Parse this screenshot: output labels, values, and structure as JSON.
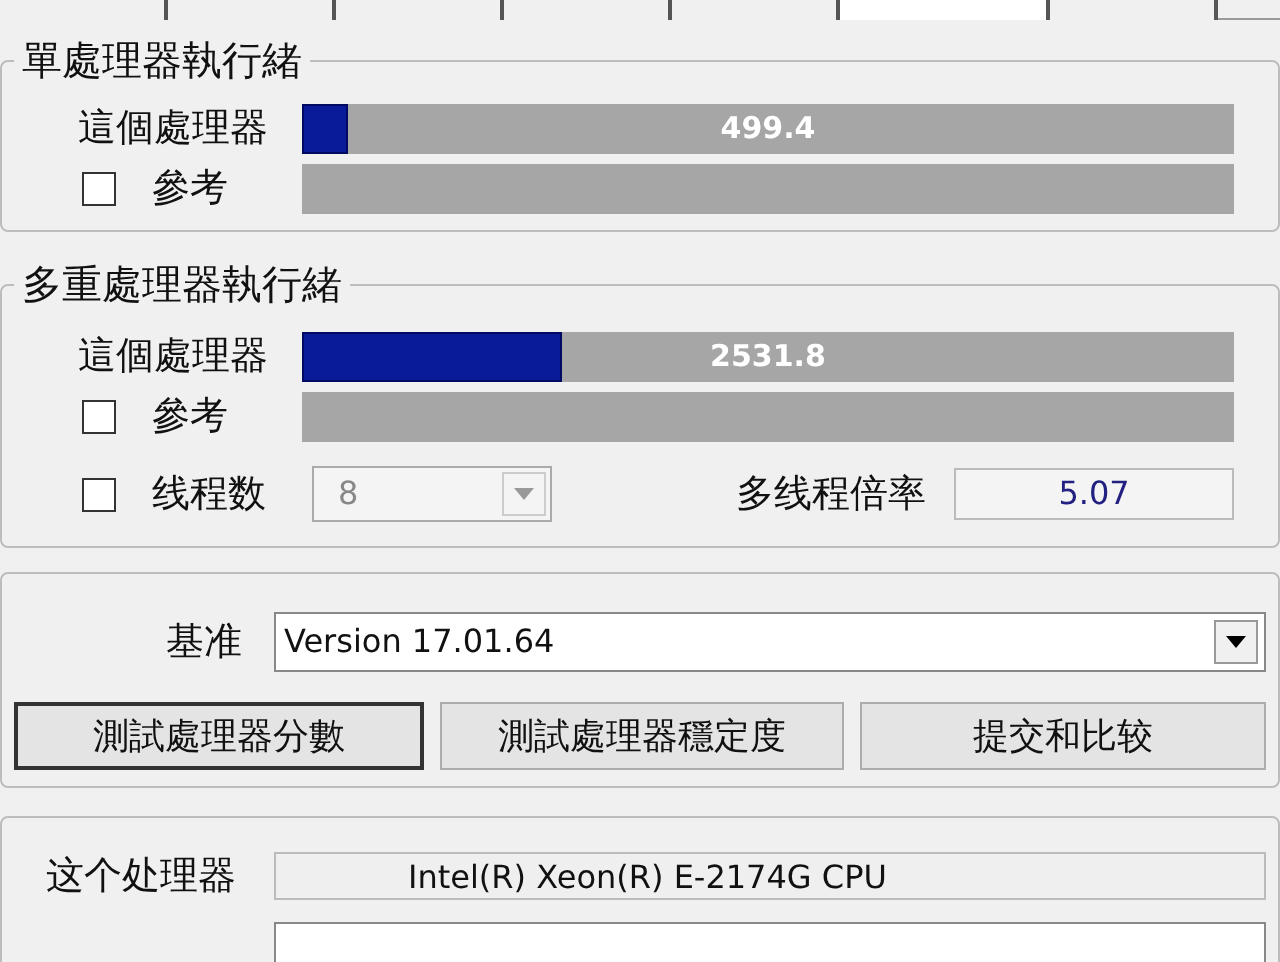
{
  "tabs": [
    {
      "selected": false
    },
    {
      "selected": false
    },
    {
      "selected": false
    },
    {
      "selected": false
    },
    {
      "selected": false
    },
    {
      "selected": true
    },
    {
      "selected": false
    }
  ],
  "single_thread": {
    "title": "單處理器執行緒",
    "rows": [
      {
        "kind": "bar",
        "label": "這個處理器",
        "level": 0.05,
        "reading": "499.4"
      },
      {
        "kind": "check",
        "label": "參考",
        "checked": false
      }
    ]
  },
  "multi_thread": {
    "title": "多重處理器執行緒",
    "rows": [
      {
        "kind": "bar",
        "label": "這個處理器",
        "level": 0.28,
        "reading": "2531.8"
      },
      {
        "kind": "check",
        "label": "參考",
        "checked": false
      }
    ],
    "threads": {
      "label": "线程数",
      "checked": false,
      "value": "8",
      "disabled": true
    },
    "ratio": {
      "label": "多线程倍率",
      "value": "5.07"
    }
  },
  "baseline": {
    "label": "基准",
    "value": "Version 17.01.64"
  },
  "buttons": [
    "測試處理器分數",
    "測試處理器穩定度",
    "提交和比较"
  ],
  "this_processor": {
    "label": "这个处理器",
    "value": "Intel(R) Xeon(R) E-2174G CPU"
  }
}
